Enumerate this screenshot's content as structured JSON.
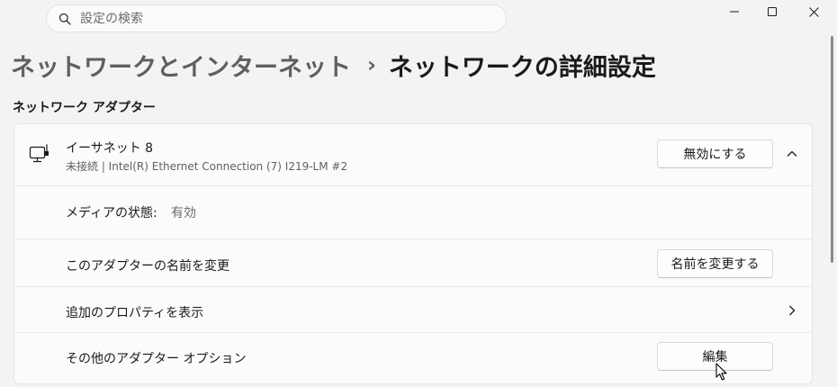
{
  "search": {
    "placeholder": "設定の検索",
    "value": ""
  },
  "window_controls": {
    "minimize": "minimize",
    "maximize": "maximize",
    "close": "close"
  },
  "breadcrumb": {
    "parent": "ネットワークとインターネット",
    "separator": "›",
    "current": "ネットワークの詳細設定"
  },
  "section_title": "ネットワーク アダプター",
  "adapter": {
    "name": "イーサネット 8",
    "status": "未接続 | Intel(R) Ethernet Connection (7) I219-LM #2",
    "disable_button": "無効にする",
    "expanded": true
  },
  "rows": {
    "media_state_label": "メディアの状態:",
    "media_state_value": "有効",
    "rename_label": "このアダプターの名前を変更",
    "rename_button": "名前を変更する",
    "properties_label": "追加のプロパティを表示",
    "options_label": "その他のアダプター オプション",
    "edit_button": "編集"
  },
  "icons": {
    "search": "search-icon",
    "adapter": "ethernet-adapter-icon",
    "collapse": "chevron-up-icon",
    "properties": "chevron-right-icon",
    "cursor": "mouse-pointer-icon"
  }
}
